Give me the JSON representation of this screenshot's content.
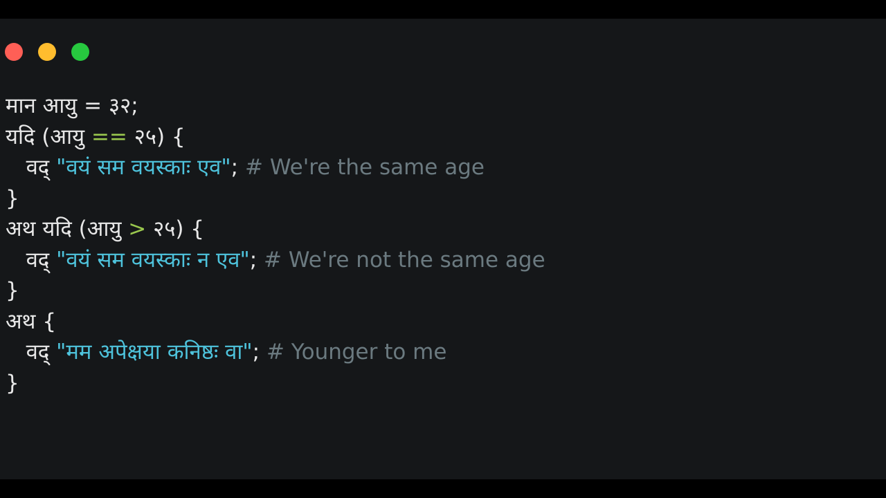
{
  "window": {
    "traffic_lights": [
      {
        "name": "close",
        "color": "#ff5f56",
        "label": ""
      },
      {
        "name": "minimize",
        "color": "#ffbd2e",
        "label": ""
      },
      {
        "name": "zoom",
        "color": "#27c93f",
        "label": ""
      }
    ]
  },
  "theme": {
    "background": "#151719",
    "letterbox": "#000000",
    "plain": "#e8e8e8",
    "string": "#4ec3dc",
    "operator": "#9ac84e",
    "comment": "#6b7a80"
  },
  "code": {
    "lines": [
      {
        "indent": "",
        "tokens": [
          {
            "type": "plain",
            "text": "मान आयु = "
          },
          {
            "type": "number",
            "text": "३२"
          },
          {
            "type": "plain",
            "text": ";"
          }
        ]
      },
      {
        "indent": "",
        "tokens": [
          {
            "type": "plain",
            "text": "यदि (आयु "
          },
          {
            "type": "op",
            "text": "=="
          },
          {
            "type": "plain",
            "text": " २५) {"
          }
        ]
      },
      {
        "indent": "   ",
        "tokens": [
          {
            "type": "plain",
            "text": "वद् "
          },
          {
            "type": "string",
            "text": "\"वयं सम वयस्काः एव\""
          },
          {
            "type": "plain",
            "text": "; "
          },
          {
            "type": "comment",
            "text": "# We're the same age"
          }
        ]
      },
      {
        "indent": "",
        "tokens": [
          {
            "type": "plain",
            "text": "}"
          }
        ]
      },
      {
        "indent": "",
        "tokens": [
          {
            "type": "plain",
            "text": "अथ यदि (आयु "
          },
          {
            "type": "op",
            "text": ">"
          },
          {
            "type": "plain",
            "text": " २५) {"
          }
        ]
      },
      {
        "indent": "   ",
        "tokens": [
          {
            "type": "plain",
            "text": "वद् "
          },
          {
            "type": "string",
            "text": "\"वयं सम वयस्काः न एव\""
          },
          {
            "type": "plain",
            "text": "; "
          },
          {
            "type": "comment",
            "text": "# We're not the same age"
          }
        ]
      },
      {
        "indent": "",
        "tokens": [
          {
            "type": "plain",
            "text": "}"
          }
        ]
      },
      {
        "indent": "",
        "tokens": [
          {
            "type": "plain",
            "text": "अथ {"
          }
        ]
      },
      {
        "indent": "   ",
        "tokens": [
          {
            "type": "plain",
            "text": "वद् "
          },
          {
            "type": "string",
            "text": "\"मम अपेक्षया कनिष्ठः वा\""
          },
          {
            "type": "plain",
            "text": "; "
          },
          {
            "type": "comment",
            "text": "# Younger to me"
          }
        ]
      },
      {
        "indent": "",
        "tokens": [
          {
            "type": "plain",
            "text": "}"
          }
        ]
      }
    ]
  }
}
